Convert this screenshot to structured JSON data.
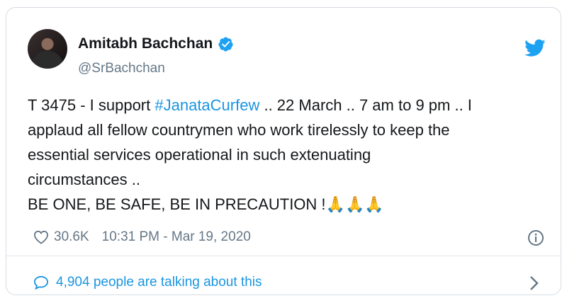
{
  "tweet": {
    "author": {
      "name": "Amitabh Bachchan",
      "handle": "@SrBachchan",
      "verified": true
    },
    "text": {
      "line1_prefix": "T 3475 - I support ",
      "hashtag": "#JanataCurfew",
      "line1_suffix": " .. 22 March .. 7 am to 9 pm .. I",
      "line2": "applaud all fellow countrymen who work tirelessly to keep the",
      "line3": "essential services operational in such extenuating",
      "line4": "circumstances ..",
      "line5": "BE ONE, BE SAFE, BE IN PRECAUTION !",
      "emoji": "🙏🙏🙏"
    },
    "likes": "30.6K",
    "timestamp": "10:31 PM - Mar 19, 2020",
    "conversation": "4,904 people are talking about this"
  },
  "colors": {
    "link": "#1b95e0",
    "muted": "#657786",
    "text": "#14171a",
    "border": "#d5dce2"
  },
  "icons": [
    "verified-badge-icon",
    "twitter-bird-icon",
    "heart-icon",
    "info-icon",
    "comment-bubble-icon",
    "chevron-right-icon"
  ]
}
